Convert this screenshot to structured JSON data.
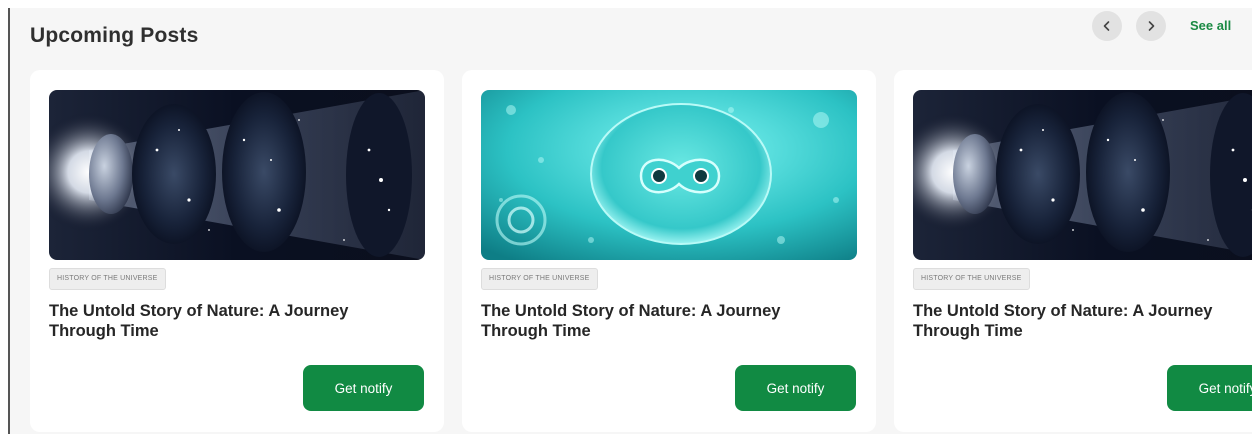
{
  "section": {
    "title": "Upcoming Posts",
    "see_all_label": "See all"
  },
  "colors": {
    "accent": "#118a43",
    "link": "#1b8a44",
    "panel_bg": "#f6f6f6",
    "card_bg": "#ffffff"
  },
  "navigation": {
    "prev_icon": "chevron-left-icon",
    "next_icon": "chevron-right-icon"
  },
  "cards": [
    {
      "image": "cosmic-expansion-illustration",
      "tag": "HISTORY OF THE UNIVERSE",
      "title": "The Untold Story of Nature: A Journey Through Time",
      "button_label": "Get notify"
    },
    {
      "image": "cell-division-illustration",
      "tag": "HISTORY OF THE UNIVERSE",
      "title": "The Untold Story of Nature: A Journey Through Time",
      "button_label": "Get notify"
    },
    {
      "image": "cosmic-expansion-illustration",
      "tag": "HISTORY OF THE UNIVERSE",
      "title": "The Untold Story of Nature: A Journey Through Time",
      "button_label": "Get notify"
    }
  ]
}
